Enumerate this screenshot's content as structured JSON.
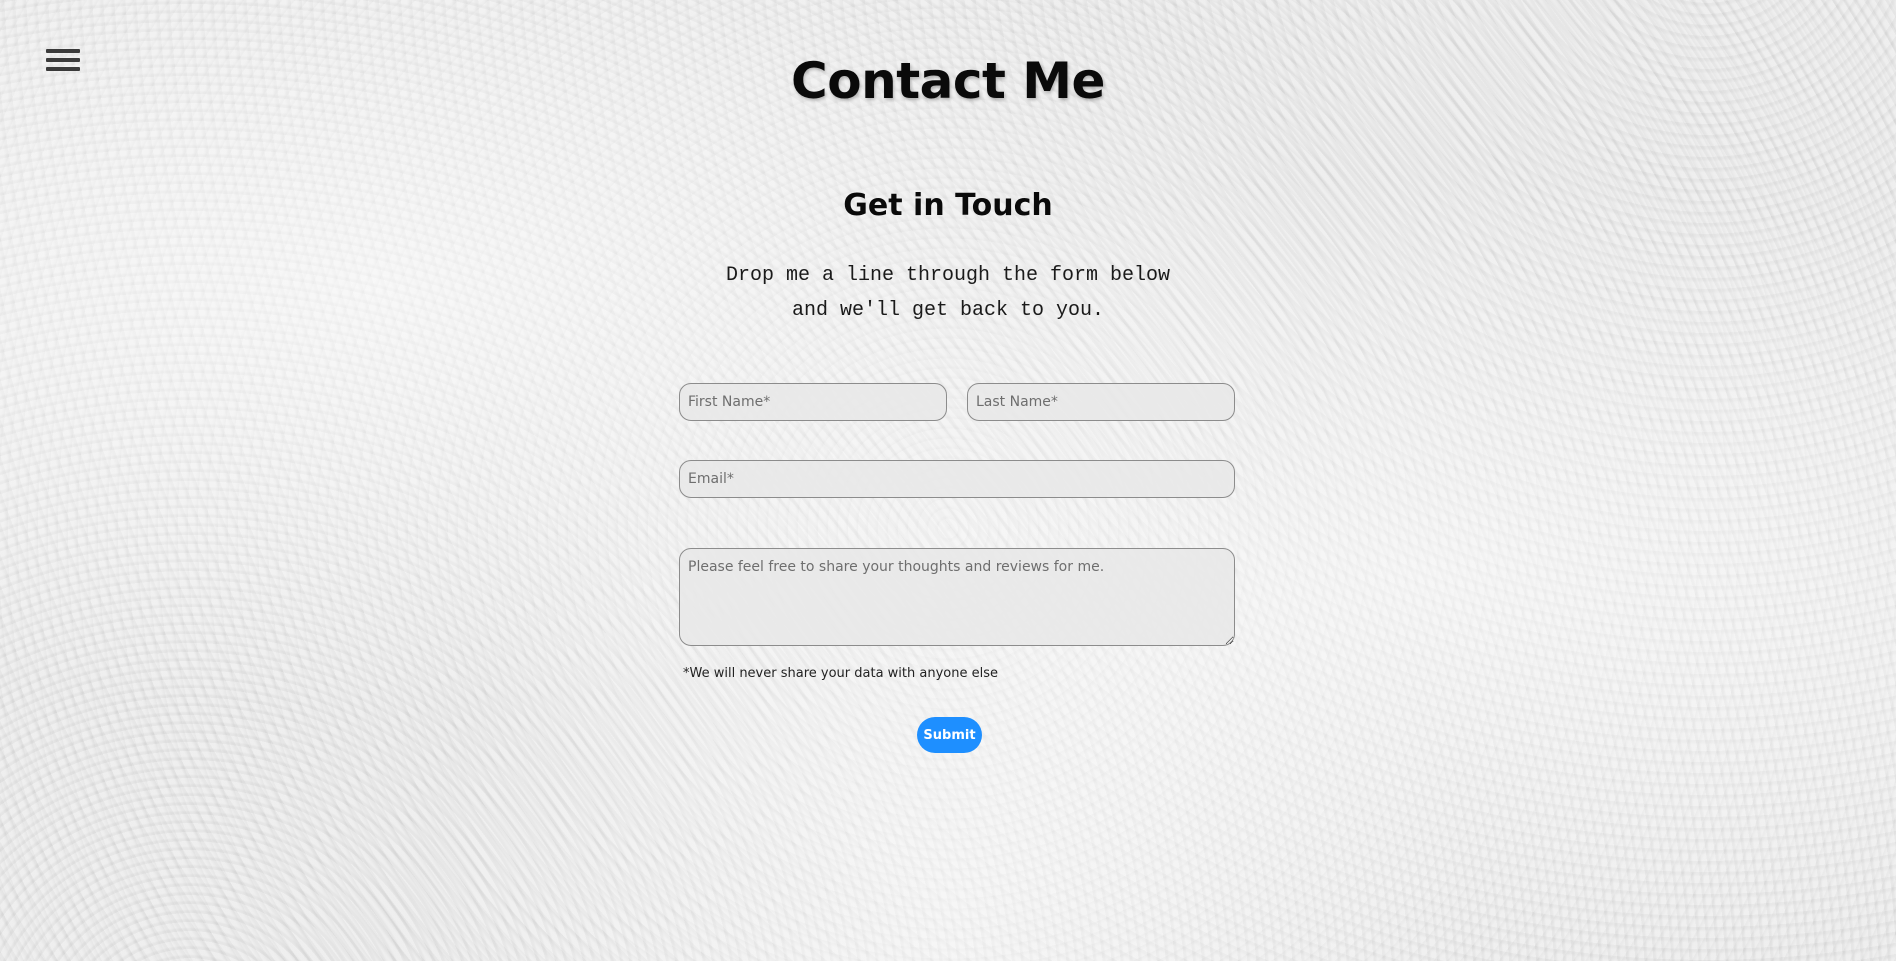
{
  "header": {
    "menu_icon": "hamburger-menu-icon",
    "title": "Contact Me"
  },
  "contact": {
    "heading": "Get in Touch",
    "intro_line_1": "Drop me a line through the form below",
    "intro_line_2": "and we'll get back to you."
  },
  "form": {
    "first_name": {
      "placeholder": "First Name*",
      "value": ""
    },
    "last_name": {
      "placeholder": "Last Name*",
      "value": ""
    },
    "email": {
      "placeholder": "Email*",
      "value": ""
    },
    "message": {
      "placeholder": "Please feel free to share your thoughts and reviews for me.",
      "value": ""
    },
    "disclaimer": "*We will never share your data with anyone else",
    "submit_label": "Submit"
  },
  "colors": {
    "accent": "#1e8fff",
    "background": "#ececec",
    "text": "#0a0a0a"
  }
}
